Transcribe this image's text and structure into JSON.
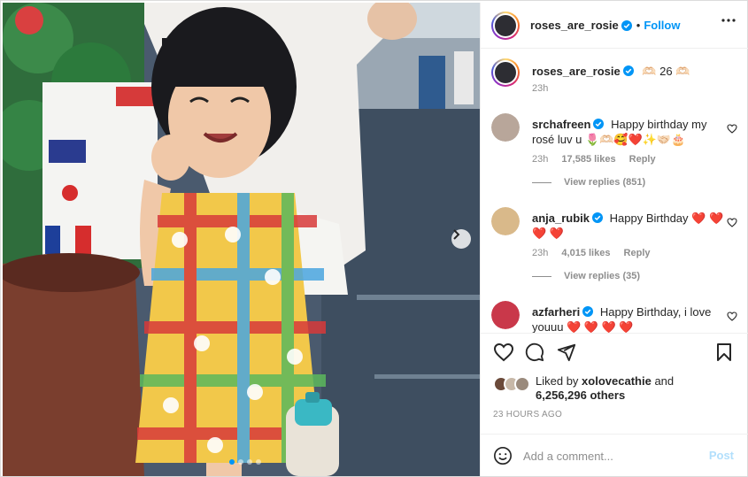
{
  "post": {
    "username": "roses_are_rosie",
    "follow_label": "Follow",
    "separator": "•"
  },
  "caption": {
    "username": "roses_are_rosie",
    "text": "🫶🏻 26 🫶🏻",
    "time": "23h"
  },
  "comments": [
    {
      "username": "srchafreen",
      "text": "Happy birthday my rosé luv u 🌷🫶🏻🥰❤️✨🤝🏻🎂",
      "time": "23h",
      "likes": "17,585 likes",
      "reply_label": "Reply",
      "view_replies": "View replies (851)"
    },
    {
      "username": "anja_rubik",
      "text": "Happy Birthday ❤️ ❤️ ❤️ ❤️",
      "time": "23h",
      "likes": "4,015 likes",
      "reply_label": "Reply",
      "view_replies": "View replies (35)"
    },
    {
      "username": "azfarheri",
      "text": "Happy Birthday, i love youuu ❤️ ❤️ ❤️ ❤️"
    }
  ],
  "likes": {
    "prefix": "Liked by",
    "user": "xolovecathie",
    "conjunction": "and",
    "others": "6,256,296 others"
  },
  "timestamp": "23 HOURS AGO",
  "add_comment": {
    "placeholder": "Add a comment...",
    "post_label": "Post"
  },
  "carousel": {
    "total_slides": 4,
    "active_index": 0
  },
  "colors": {
    "accent": "#0095f6",
    "post_disabled": "#b2dffc",
    "muted": "#8e8e8e"
  }
}
